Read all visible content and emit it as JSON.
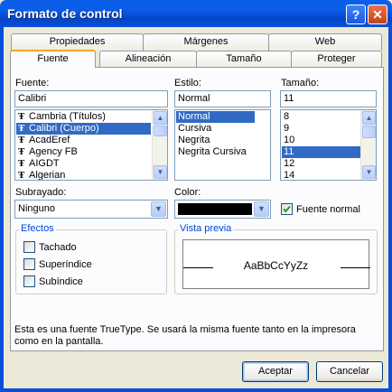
{
  "window": {
    "title": "Formato de control",
    "help": "?",
    "close": "✕"
  },
  "tabs_back": [
    "Propiedades",
    "Márgenes",
    "Web"
  ],
  "tabs_front": [
    "Fuente",
    "Alineación",
    "Tamaño",
    "Proteger"
  ],
  "font": {
    "label": "Fuente:",
    "value": "Calibri",
    "items": [
      "Cambria (Títulos)",
      "Calibri (Cuerpo)",
      "AcadEref",
      "Agency FB",
      "AIGDT",
      "Algerian"
    ],
    "selected_index": 1
  },
  "style": {
    "label": "Estilo:",
    "value": "Normal",
    "items": [
      "Normal",
      "Cursiva",
      "Negrita",
      "Negrita Cursiva"
    ],
    "selected_index": 0
  },
  "size": {
    "label": "Tamaño:",
    "value": "11",
    "items": [
      "8",
      "9",
      "10",
      "11",
      "12",
      "14"
    ],
    "selected_index": 3
  },
  "underline": {
    "label": "Subrayado:",
    "value": "Ninguno"
  },
  "color": {
    "label": "Color:",
    "value_hex": "#000000"
  },
  "normal_font": {
    "label": "Fuente normal",
    "checked": true
  },
  "effects": {
    "legend": "Efectos",
    "items": [
      {
        "label": "Tachado",
        "checked": false
      },
      {
        "label": "Superíndice",
        "checked": false
      },
      {
        "label": "Subíndice",
        "checked": false
      }
    ]
  },
  "preview": {
    "legend": "Vista previa",
    "sample": "AaBbCcYyZz"
  },
  "info": "Esta es una fuente TrueType. Se usará la misma fuente tanto en la impresora como en la pantalla.",
  "buttons": {
    "ok": "Aceptar",
    "cancel": "Cancelar"
  },
  "colors": {
    "accent": "#0a5ee8",
    "selection": "#316ac5",
    "tab_highlight": "#f5a623",
    "group_legend": "#0046d5"
  }
}
